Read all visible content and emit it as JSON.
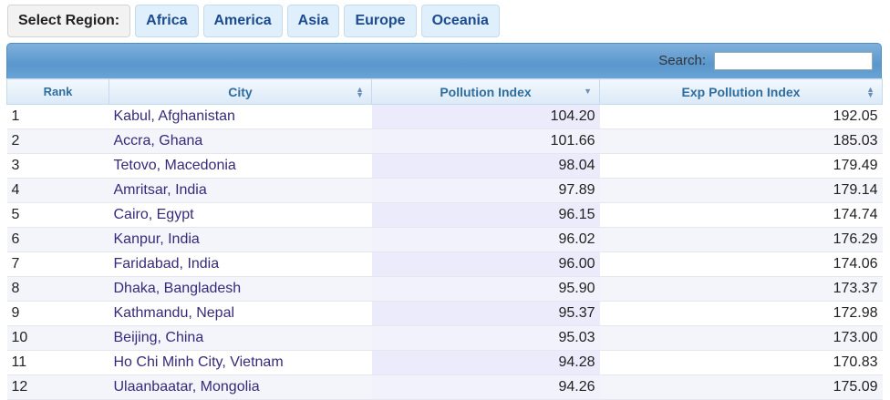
{
  "region_bar": {
    "label": "Select Region:",
    "buttons": [
      "Africa",
      "America",
      "Asia",
      "Europe",
      "Oceania"
    ]
  },
  "search": {
    "label": "Search:",
    "value": ""
  },
  "columns": [
    "Rank",
    "City",
    "Pollution Index",
    "Exp Pollution Index"
  ],
  "rows": [
    {
      "rank": "1",
      "city": "Kabul, Afghanistan",
      "pollution": "104.20",
      "exp": "192.05"
    },
    {
      "rank": "2",
      "city": "Accra, Ghana",
      "pollution": "101.66",
      "exp": "185.03"
    },
    {
      "rank": "3",
      "city": "Tetovo, Macedonia",
      "pollution": "98.04",
      "exp": "179.49"
    },
    {
      "rank": "4",
      "city": "Amritsar, India",
      "pollution": "97.89",
      "exp": "179.14"
    },
    {
      "rank": "5",
      "city": "Cairo, Egypt",
      "pollution": "96.15",
      "exp": "174.74"
    },
    {
      "rank": "6",
      "city": "Kanpur, India",
      "pollution": "96.02",
      "exp": "176.29"
    },
    {
      "rank": "7",
      "city": "Faridabad, India",
      "pollution": "96.00",
      "exp": "174.06"
    },
    {
      "rank": "8",
      "city": "Dhaka, Bangladesh",
      "pollution": "95.90",
      "exp": "173.37"
    },
    {
      "rank": "9",
      "city": "Kathmandu, Nepal",
      "pollution": "95.37",
      "exp": "172.98"
    },
    {
      "rank": "10",
      "city": "Beijing, China",
      "pollution": "95.03",
      "exp": "173.00"
    },
    {
      "rank": "11",
      "city": "Ho Chi Minh City, Vietnam",
      "pollution": "94.28",
      "exp": "170.83"
    },
    {
      "rank": "12",
      "city": "Ulaanbaatar, Mongolia",
      "pollution": "94.26",
      "exp": "175.09"
    }
  ],
  "colors": {
    "link": "#362b7a",
    "header_text": "#2e6e9e",
    "toolbar": "#5a97cd"
  }
}
